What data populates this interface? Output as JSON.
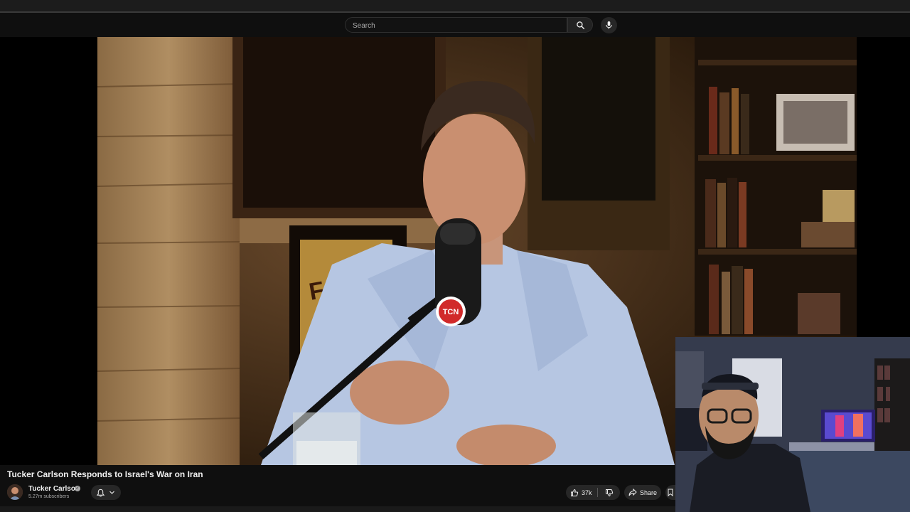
{
  "search": {
    "placeholder": "Search"
  },
  "video": {
    "title": "Tucker Carlson Responds to Israel's War on Iran",
    "mic_logo": "TCN",
    "poster_text": "FATH"
  },
  "channel": {
    "name": "Tucker Carlson",
    "subscribers": "5.27m subscribers"
  },
  "actions": {
    "likes": "37k",
    "share_label": "Share"
  },
  "icons": {
    "search": "search-icon",
    "mic": "mic-icon",
    "bell": "bell-icon",
    "chevron": "chevron-down-icon",
    "like": "thumbs-up-icon",
    "dislike": "thumbs-down-icon",
    "share": "share-icon",
    "verified": "verified-icon"
  },
  "colors": {
    "background": "#0f0f0f",
    "chip": "#272727",
    "text": "#f1f1f1",
    "muted": "#aaaaaa"
  }
}
